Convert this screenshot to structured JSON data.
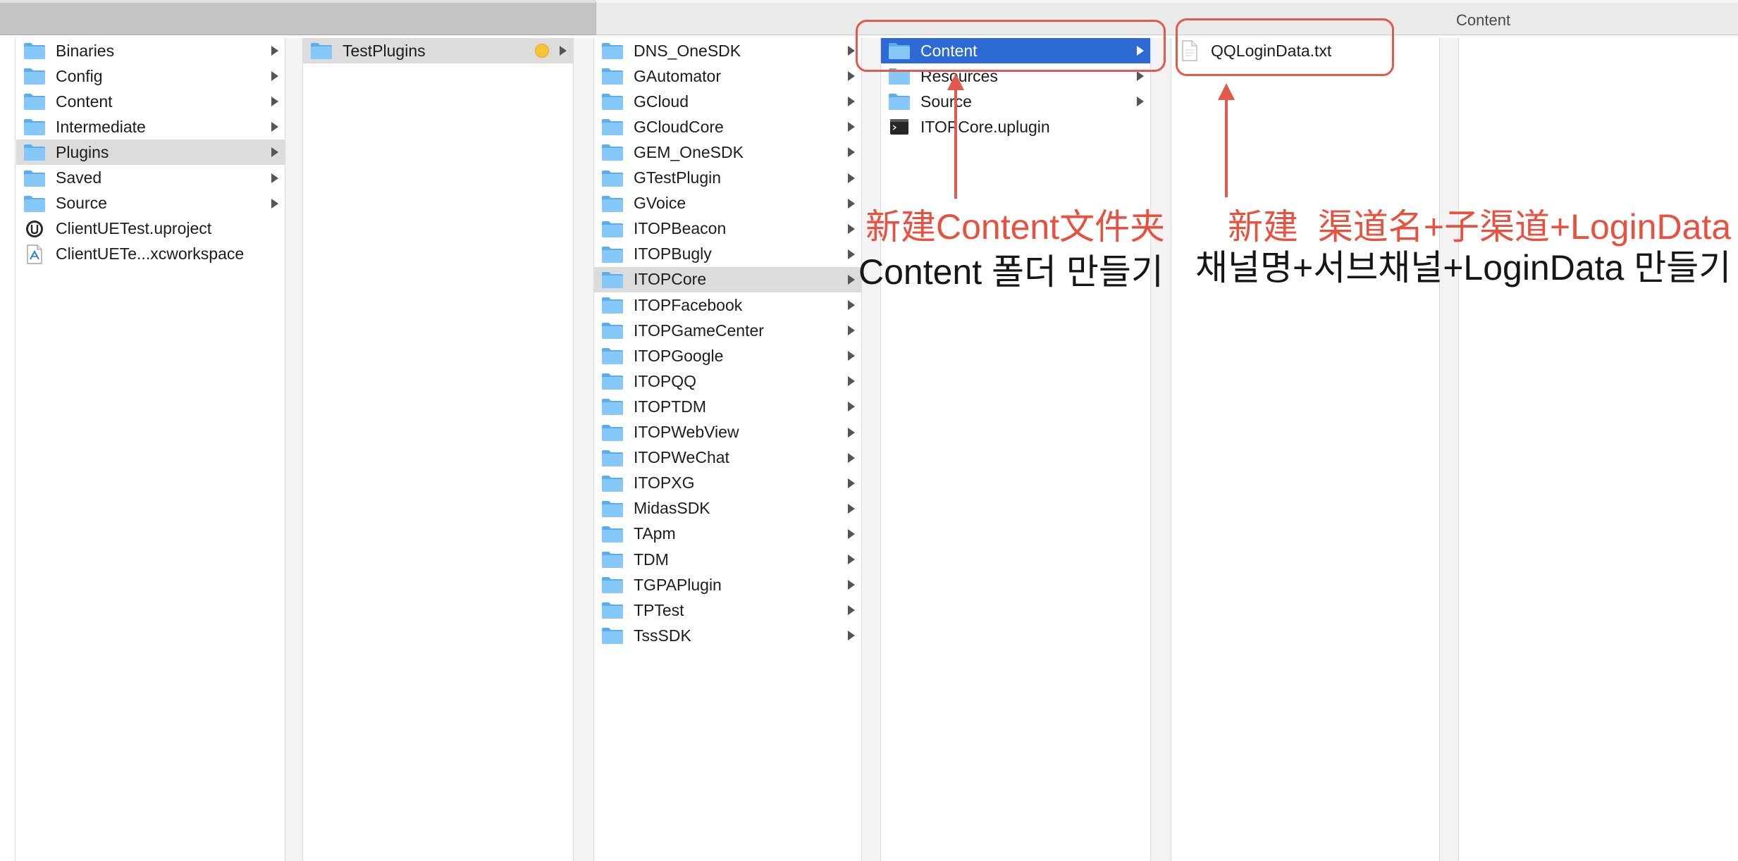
{
  "window": {
    "title": "Content"
  },
  "colors": {
    "selection_blue": "#2e6ad3",
    "selection_gray": "#dcdcdc",
    "folder_blue": "#6cb8f5",
    "annotation_red": "#e8503f",
    "tag_yellow": "#f5c437"
  },
  "columns": [
    {
      "items": [
        {
          "label": "Binaries",
          "icon": "folder-icon",
          "chevron": true
        },
        {
          "label": "Config",
          "icon": "folder-icon",
          "chevron": true
        },
        {
          "label": "Content",
          "icon": "folder-icon",
          "chevron": true
        },
        {
          "label": "Intermediate",
          "icon": "folder-icon",
          "chevron": true
        },
        {
          "label": "Plugins",
          "icon": "folder-icon",
          "chevron": true,
          "state": "gray"
        },
        {
          "label": "Saved",
          "icon": "folder-icon",
          "chevron": true
        },
        {
          "label": "Source",
          "icon": "folder-icon",
          "chevron": true
        },
        {
          "label": "ClientUETest.uproject",
          "icon": "unreal-project-icon",
          "chevron": false
        },
        {
          "label": "ClientUETe...xcworkspace",
          "icon": "xcode-workspace-icon",
          "chevron": false
        }
      ]
    },
    {
      "items": [
        {
          "label": "TestPlugins",
          "icon": "folder-icon",
          "chevron": true,
          "state": "gray",
          "tag": "yellow-tag"
        }
      ]
    },
    {
      "items": [
        {
          "label": "DNS_OneSDK",
          "icon": "folder-icon",
          "chevron": true
        },
        {
          "label": "GAutomator",
          "icon": "folder-icon",
          "chevron": true
        },
        {
          "label": "GCloud",
          "icon": "folder-icon",
          "chevron": true
        },
        {
          "label": "GCloudCore",
          "icon": "folder-icon",
          "chevron": true
        },
        {
          "label": "GEM_OneSDK",
          "icon": "folder-icon",
          "chevron": true
        },
        {
          "label": "GTestPlugin",
          "icon": "folder-icon",
          "chevron": true
        },
        {
          "label": "GVoice",
          "icon": "folder-icon",
          "chevron": true
        },
        {
          "label": "ITOPBeacon",
          "icon": "folder-icon",
          "chevron": true
        },
        {
          "label": "ITOPBugly",
          "icon": "folder-icon",
          "chevron": true
        },
        {
          "label": "ITOPCore",
          "icon": "folder-icon",
          "chevron": true,
          "state": "gray"
        },
        {
          "label": "ITOPFacebook",
          "icon": "folder-icon",
          "chevron": true
        },
        {
          "label": "ITOPGameCenter",
          "icon": "folder-icon",
          "chevron": true
        },
        {
          "label": "ITOPGoogle",
          "icon": "folder-icon",
          "chevron": true
        },
        {
          "label": "ITOPQQ",
          "icon": "folder-icon",
          "chevron": true
        },
        {
          "label": "ITOPTDM",
          "icon": "folder-icon",
          "chevron": true
        },
        {
          "label": "ITOPWebView",
          "icon": "folder-icon",
          "chevron": true
        },
        {
          "label": "ITOPWeChat",
          "icon": "folder-icon",
          "chevron": true
        },
        {
          "label": "ITOPXG",
          "icon": "folder-icon",
          "chevron": true
        },
        {
          "label": "MidasSDK",
          "icon": "folder-icon",
          "chevron": true
        },
        {
          "label": "TApm",
          "icon": "folder-icon",
          "chevron": true
        },
        {
          "label": "TDM",
          "icon": "folder-icon",
          "chevron": true
        },
        {
          "label": "TGPAPlugin",
          "icon": "folder-icon",
          "chevron": true
        },
        {
          "label": "TPTest",
          "icon": "folder-icon",
          "chevron": true
        },
        {
          "label": "TssSDK",
          "icon": "folder-icon",
          "chevron": true
        }
      ]
    },
    {
      "items": [
        {
          "label": "Content",
          "icon": "folder-icon",
          "chevron": true,
          "state": "blue"
        },
        {
          "label": "Resources",
          "icon": "folder-icon",
          "chevron": true
        },
        {
          "label": "Source",
          "icon": "folder-icon",
          "chevron": true
        },
        {
          "label": "ITOPCore.uplugin",
          "icon": "terminal-file-icon",
          "chevron": false
        }
      ]
    },
    {
      "items": [
        {
          "label": "QQLoginData.txt",
          "icon": "text-document-icon",
          "chevron": false
        }
      ]
    },
    {
      "items": []
    }
  ],
  "annotations": {
    "content_folder_cn": "新建Content文件夹",
    "content_folder_kr": "Content 폴더 만들기",
    "login_data_cn": "新建  渠道名+子渠道+LoginData",
    "login_data_kr": "채널명+서브채널+LoginData 만들기"
  }
}
